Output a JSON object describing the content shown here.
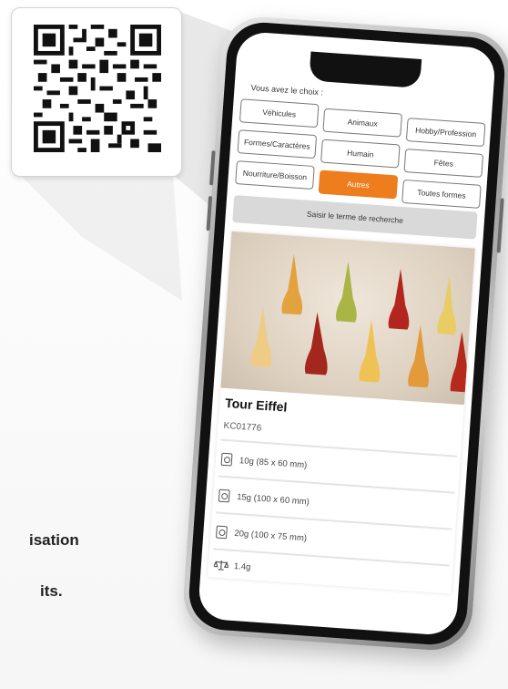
{
  "qr_card": {
    "icon": "qr-code-icon"
  },
  "side_text": {
    "line1": "isation",
    "line2": "its."
  },
  "app": {
    "choice_prompt": "Vous avez le choix :",
    "categories": [
      {
        "label": "Véhicules",
        "active": false
      },
      {
        "label": "Animaux",
        "active": false
      },
      {
        "label": "Hobby/Profession",
        "active": false
      },
      {
        "label": "Formes/Caractères",
        "active": false
      },
      {
        "label": "Humain",
        "active": false
      },
      {
        "label": "Fêtes",
        "active": false
      },
      {
        "label": "Nourriture/Boisson",
        "active": false
      },
      {
        "label": "Autres",
        "active": true
      },
      {
        "label": "Toutes formes",
        "active": false
      }
    ],
    "search_label": "Saisir le terme de recherche",
    "product": {
      "title": "Tour Eiffel",
      "code": "KC01776",
      "sizes": [
        {
          "label": "10g (85 x 60 mm)",
          "icon": "mold-icon"
        },
        {
          "label": "15g (100 x 60 mm)",
          "icon": "mold-icon"
        },
        {
          "label": "20g (100 x 75 mm)",
          "icon": "mold-icon"
        }
      ],
      "weight": {
        "label": "1.4g",
        "icon": "scale-icon"
      }
    }
  },
  "colors": {
    "accent": "#ee7d1e",
    "search_bg": "#d9d9d9"
  }
}
